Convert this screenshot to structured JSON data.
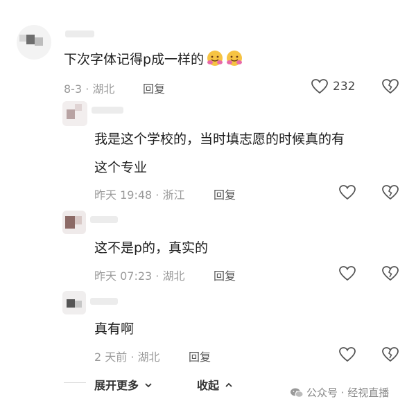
{
  "comments": [
    {
      "text": "下次字体记得p成一样的",
      "meta": "8-3 · 湖北",
      "reply": "回复",
      "likes": "232",
      "emoji": [
        "hug-emoji",
        "hug-emoji"
      ]
    },
    {
      "text_line1": "我是这个学校的，当时填志愿的时候真的有",
      "text_line2": "这个专业",
      "meta": "昨天 19:48 · 浙江",
      "reply": "回复"
    },
    {
      "text": "这不是p的，真实的",
      "meta": "昨天 07:23 · 湖北",
      "reply": "回复"
    },
    {
      "text": "真有啊",
      "meta": "2 天前 · 湖北",
      "reply": "回复"
    }
  ],
  "footer": {
    "expand": "展开更多",
    "collapse": "收起"
  },
  "watermark": "公众号 · 经视直播",
  "icons": [
    "heart-icon",
    "broken-heart-icon",
    "chevron-down-icon",
    "chevron-up-icon",
    "wechat-icon"
  ],
  "colors": {
    "text": "#1e1e1e",
    "meta": "#9a9a9a",
    "icon": "#555555"
  }
}
